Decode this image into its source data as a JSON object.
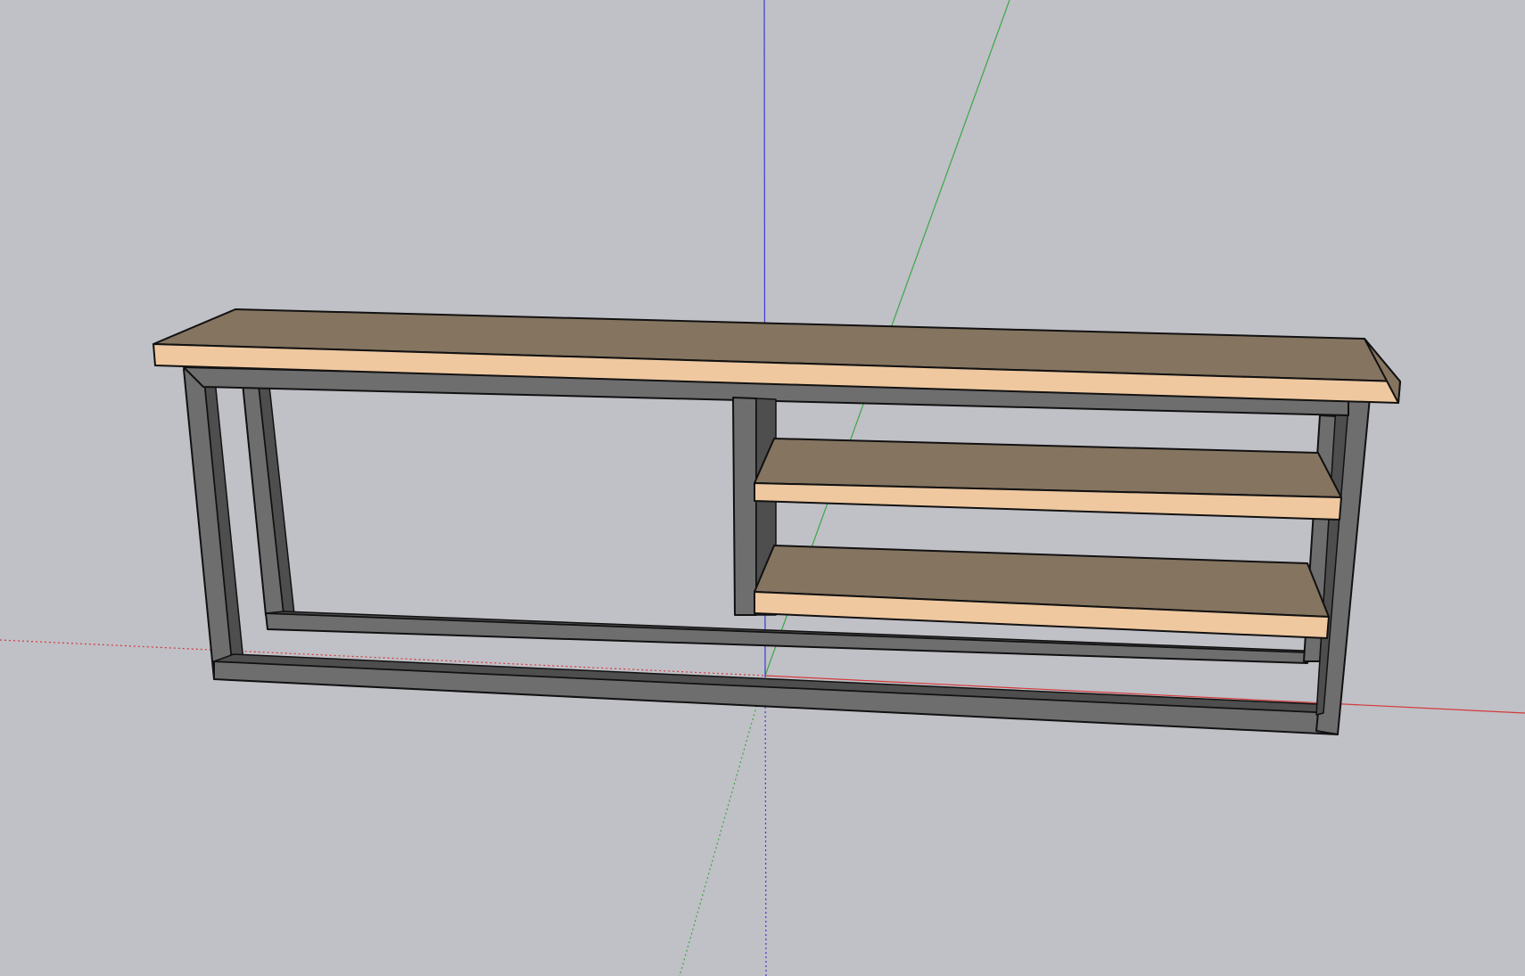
{
  "viewport": {
    "background_color": "#c0c0c7"
  },
  "axes": {
    "red_axis_color": "#d23a3a",
    "green_axis_color": "#3aa845",
    "blue_axis_color": "#3a3ad2"
  },
  "model": {
    "wood_top_color": "#857460",
    "wood_edge_color": "#efc8a0",
    "metal_color": "#6e6e6e",
    "metal_dark_color": "#4e4e4e",
    "outline_color": "#111111"
  }
}
